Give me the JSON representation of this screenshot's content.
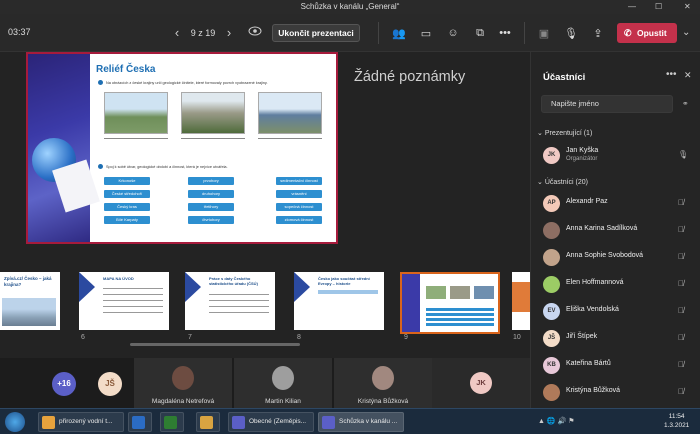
{
  "window": {
    "title": "Schůzka v kanálu „General“"
  },
  "toolbar": {
    "timer": "03:37",
    "slide_counter": "9 z 19",
    "stop_presenting": "Ukončit prezentaci",
    "leave": "Opustit"
  },
  "slide": {
    "title": "Reliéf Česka",
    "instruction1": "Na obrázcích z české krajiny urči geologické činitele, které formovaly povrch vyobrazené krajiny.",
    "instruction2": "Spoj k sobě útvar, geologické období a činnost, která je nejvíce utvářela.",
    "col1": [
      "Krkonoše",
      "České středohoří",
      "Český kras",
      "Bílé Karpaty"
    ],
    "col2": [
      "prvohory",
      "druhohory",
      "třetihory",
      "čtvrtohory"
    ],
    "col3": [
      "sedimentační činnost",
      "vrásnění",
      "sopečná činnost",
      "zlomová činnost"
    ]
  },
  "notes": "Žádné poznámky",
  "filmstrip": [
    {
      "num": "",
      "title": "Zpívá.cz/ Česko – jaká krajina?"
    },
    {
      "num": "6",
      "title": "MAPA NA ÚVOD"
    },
    {
      "num": "7",
      "title": "Práce s daty Českého statistického úřadu (ČSÚ)"
    },
    {
      "num": "8",
      "title": "Česko jako součást střední Evropy – historie"
    },
    {
      "num": "9",
      "title": ""
    },
    {
      "num": "10",
      "title": ""
    }
  ],
  "participants": {
    "title": "Účastníci",
    "search_placeholder": "Napište jméno",
    "presenters_header": "Prezentující (1)",
    "attendees_header": "Účastníci (20)",
    "presenters": [
      {
        "initials": "JK",
        "name": "Jan Kyška",
        "role": "Organizátor",
        "color": "#f0c9c4"
      }
    ],
    "attendees": [
      {
        "initials": "AP",
        "name": "Alexandr Paz",
        "color": "#f3c9b8"
      },
      {
        "initials": "",
        "name": "Anna Karina Sadílková",
        "color": "#8d6e63"
      },
      {
        "initials": "",
        "name": "Anna Sophie Svobodová",
        "color": "#c2a38b"
      },
      {
        "initials": "",
        "name": "Elen Hoffmannová",
        "color": "#9ccc65"
      },
      {
        "initials": "EV",
        "name": "Eliška Vendolská",
        "color": "#c8d6f0"
      },
      {
        "initials": "JŠ",
        "name": "Jiří Štípek",
        "color": "#f3dcc8"
      },
      {
        "initials": "KB",
        "name": "Kateřina Bártů",
        "color": "#e8c8d8"
      },
      {
        "initials": "",
        "name": "Kristýna Bůžková",
        "color": "#b07a5a"
      }
    ]
  },
  "videos": {
    "overflow": "+16",
    "js": "JŠ",
    "tiles": [
      {
        "name": "Magdaléna Netrefová",
        "color": "#6d4c41"
      },
      {
        "name": "Martin Kilian",
        "color": "#9e9e9e"
      },
      {
        "name": "Kristýna Bůžková",
        "color": "#a1887f"
      }
    ],
    "jk": "JK"
  },
  "taskbar": {
    "tasks": [
      {
        "label": "přirozený vodní t...",
        "color": "#e8a33d"
      },
      {
        "label": "",
        "color": "#2b6cc4"
      },
      {
        "label": "",
        "color": "#2e7d32"
      },
      {
        "label": "",
        "color": "#d9a441"
      },
      {
        "label": "Obecné (Zeměpis...",
        "color": "#5b5fc7"
      },
      {
        "label": "Schůzka v kanálu ...",
        "color": "#5b5fc7"
      }
    ],
    "time": "11:54",
    "date": "1.3.2021"
  }
}
